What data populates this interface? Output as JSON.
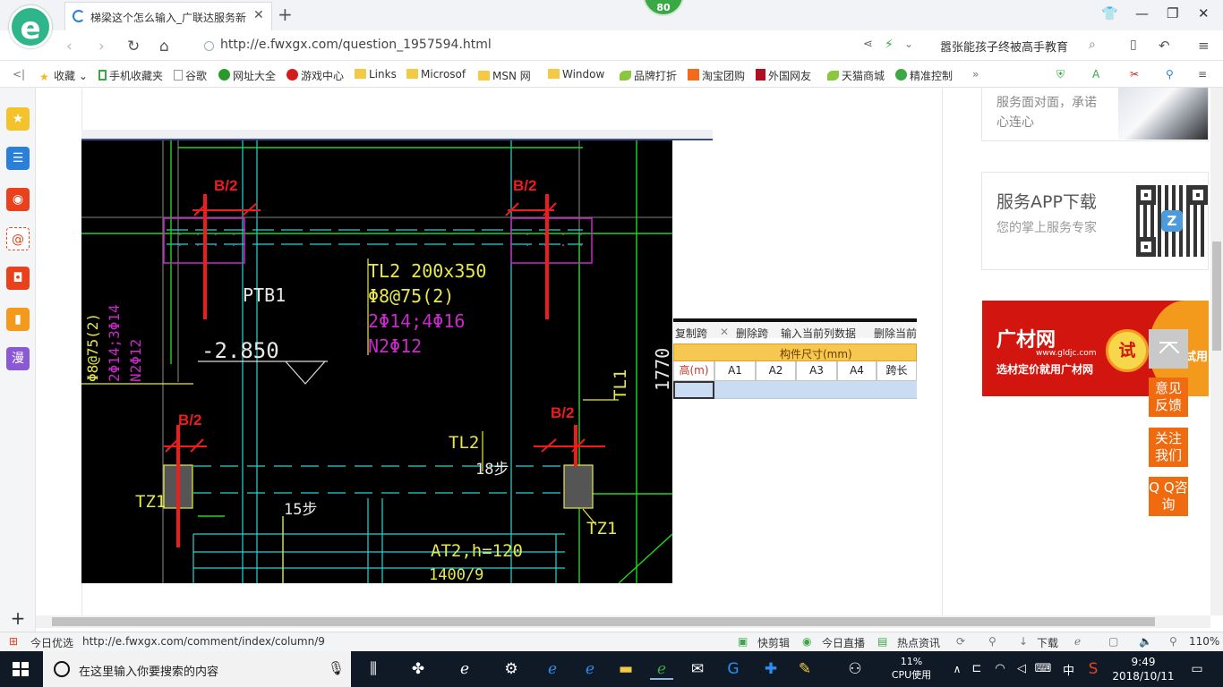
{
  "browser": {
    "tab_title": "梯梁这个怎么输入_广联达服务新",
    "badge": "80",
    "url": "http://e.fwxgx.com/question_1957594.html",
    "news_headline": "嚣张能孩子终被高手教育"
  },
  "bookmarks": [
    {
      "label": "收藏"
    },
    {
      "label": "手机收藏夹"
    },
    {
      "label": "谷歌"
    },
    {
      "label": "网址大全"
    },
    {
      "label": "游戏中心"
    },
    {
      "label": "Links"
    },
    {
      "label": "Microsof"
    },
    {
      "label": "MSN 网"
    },
    {
      "label": "Window"
    },
    {
      "label": "品牌打折"
    },
    {
      "label": "淘宝团购"
    },
    {
      "label": "外国网友"
    },
    {
      "label": "天猫商城"
    },
    {
      "label": "精准控制"
    }
  ],
  "sidebar": {
    "manga_label": "漫"
  },
  "cad": {
    "b2_labels": [
      "B/2",
      "B/2",
      "B/2",
      "B/2"
    ],
    "ptb": "PTB1",
    "elevation": "-2.850",
    "tl2_spec": [
      "TL2 200x350",
      "Φ8@75(2)",
      "2Φ14;4Φ16",
      "N2Φ12"
    ],
    "left_spec": [
      "Φ8@75(2)",
      "2Φ14;3Φ14",
      "N2Φ12"
    ],
    "tl1": "TL1",
    "dim_1770": "1770",
    "tl2_label": "TL2",
    "steps_18": "18步",
    "steps_15": "15步",
    "tz1": [
      "TZ1",
      "TZ1"
    ],
    "at2": "AT2,h=120",
    "at2_dim": "1400/9"
  },
  "software": {
    "toolbar": [
      "复制跨",
      "删除跨",
      "输入当前列数据",
      "删除当前"
    ],
    "header_group": "构件尺寸(mm)",
    "columns": [
      "高(m)",
      "A1",
      "A2",
      "A3",
      "A4",
      "跨长"
    ]
  },
  "right_column": {
    "card1_text": "服务面对面，承诺心连心",
    "app_title": "服务APP下载",
    "app_sub": "您的掌上服务专家",
    "ad_brand": "广材网",
    "ad_domain": "www.gldjc.com",
    "ad_slogan": "选材定价就用广材网",
    "ad_try": "试",
    "ad_trial": "试用"
  },
  "float_buttons": [
    "意见反馈",
    "关注我们",
    "Q Q咨询"
  ],
  "statusbar": {
    "left_label": "今日优选",
    "hover_url": "http://e.fwxgx.com/comment/index/column/9",
    "items": [
      "快剪辑",
      "今日直播",
      "热点资讯",
      "下载"
    ],
    "zoom": "110%"
  },
  "taskbar": {
    "search_placeholder": "在这里输入你要搜索的内容",
    "cpu_percent": "11%",
    "cpu_label": "CPU使用",
    "ime": "中",
    "time": "9:49",
    "date": "2018/10/11"
  }
}
